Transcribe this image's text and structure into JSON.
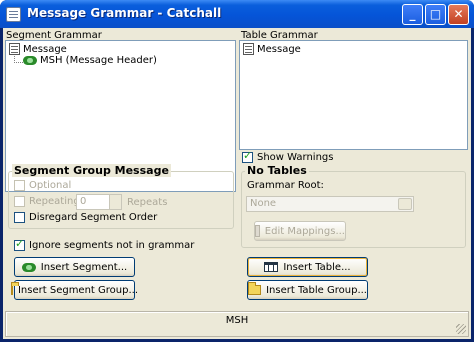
{
  "window": {
    "title": "Message Grammar - Catchall",
    "icon": "app-document-icon"
  },
  "title_buttons": {
    "minimize": "_",
    "maximize": "□",
    "close": "✕"
  },
  "segment_grammar": {
    "label": "Segment Grammar",
    "tree": [
      {
        "label": "Message",
        "icon": "document-icon"
      },
      {
        "label": "MSH (Message Header)",
        "icon": "segment-icon"
      }
    ]
  },
  "table_grammar": {
    "label": "Table Grammar",
    "tree": [
      {
        "label": "Message",
        "icon": "document-icon"
      }
    ]
  },
  "show_warnings": {
    "label": "Show Warnings",
    "checked": true
  },
  "segment_group_message": {
    "title": "Segment Group Message",
    "optional": "Optional",
    "repeating": "Repeating",
    "repeat_value": "0",
    "repeats": "Repeats",
    "disregard": "Disregard Segment Order"
  },
  "no_tables": {
    "title": "No Tables",
    "grammar_root": "Grammar Root:",
    "root_value": "None",
    "edit_mappings": "Edit Mappings..."
  },
  "ignore_segments": {
    "label": "Ignore segments not in grammar",
    "checked": true
  },
  "buttons": {
    "insert_segment": "Insert Segment...",
    "insert_segment_group": "Insert Segment Group...",
    "insert_table": "Insert Table...",
    "insert_table_group": "Insert Table Group..."
  },
  "status": {
    "text": "MSH"
  },
  "colors": {
    "titlebar": "#0554d8",
    "face": "#ece9d8",
    "border": "#7f9db9"
  }
}
